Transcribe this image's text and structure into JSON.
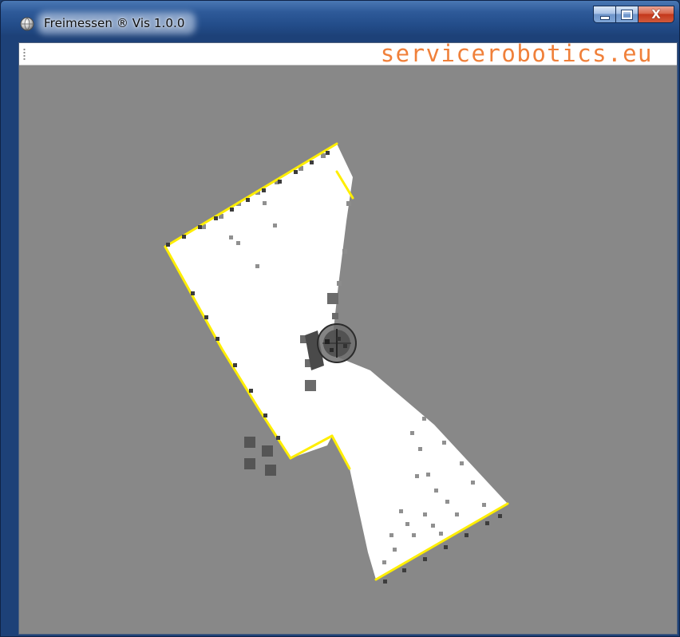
{
  "window": {
    "title": "Freimessen ® Vis 1.0.0",
    "app_icon": "globe-icon",
    "controls": {
      "minimize_icon": "minimize-icon",
      "maximize_icon": "maximize-icon",
      "close_label": "X"
    }
  },
  "toolbar": {
    "brand_text": "servicerobotics.eu",
    "brand_color": "#f0803a"
  },
  "map": {
    "background_color": "#888888",
    "free_space_color": "#ffffff",
    "wall_color": "#ffee00",
    "obstacle_color": "#555555",
    "robot_icon": "robot-icon"
  }
}
